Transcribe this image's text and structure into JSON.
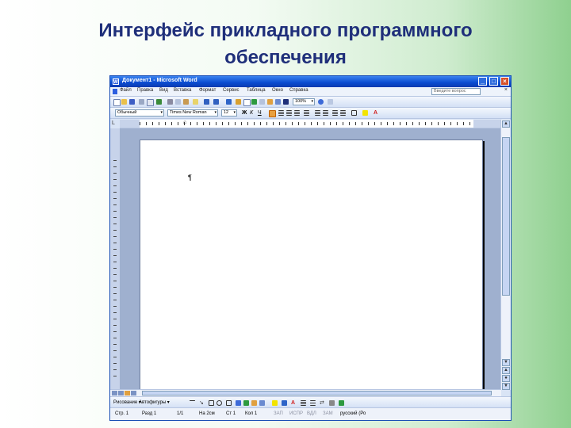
{
  "slide": {
    "title_line1": "Интерфейс прикладного программного",
    "title_line2": "обеспечения"
  },
  "window": {
    "title": "Документ1 - Microsoft Word",
    "buttons": {
      "minimize": "_",
      "maximize": "□",
      "close": "×"
    }
  },
  "menubar": {
    "items": [
      "Файл",
      "Правка",
      "Вид",
      "Вставка",
      "Формат",
      "Сервис",
      "Таблица",
      "Окно",
      "Справка"
    ],
    "help_search_placeholder": "Введите вопрос",
    "doc_close": "×"
  },
  "formatting": {
    "style": "Обычный",
    "font": "Times New Roman",
    "size": "12"
  },
  "ruler": {
    "indent_marker": "⌂",
    "corner": "L"
  },
  "document": {
    "paragraph_mark": "¶"
  },
  "drawing": {
    "draw_label": "Рисование ▾",
    "autoshapes_label": "Автофигуры ▾"
  },
  "status": {
    "page": "Стр. 1",
    "section": "Разд 1",
    "pages": "1/1",
    "at": "На 2см",
    "line": "Ст 1",
    "col": "Кол 1",
    "rec": "ЗАП",
    "trk": "ИСПР",
    "ext": "ВДЛ",
    "ovr": "ЗАМ",
    "language": "русский (Ро"
  },
  "colors": {
    "title_text": "#1f2f7a",
    "titlebar": "#0a4bd0",
    "close_button": "#d6502a",
    "toolbar_bg": "#d3e0f5",
    "workspace": "#9fb0cf"
  },
  "icons": [
    "new-icon",
    "open-icon",
    "save-icon",
    "print-icon",
    "preview-icon",
    "spelling-icon",
    "cut-icon",
    "copy-icon",
    "paste-icon",
    "undo-icon",
    "redo-icon",
    "hyperlink-icon",
    "table-icon",
    "excel-icon",
    "columns-icon",
    "drawing-icon",
    "docmap-icon",
    "paragraph-icon",
    "zoom-icon",
    "help-icon",
    "bold-icon",
    "italic-icon",
    "underline-icon",
    "align-left-icon",
    "align-center-icon",
    "align-right-icon",
    "justify-icon",
    "line-spacing-icon",
    "numbering-icon",
    "bullets-icon",
    "outdent-icon",
    "indent-icon",
    "border-icon",
    "highlight-icon",
    "font-color-icon"
  ]
}
